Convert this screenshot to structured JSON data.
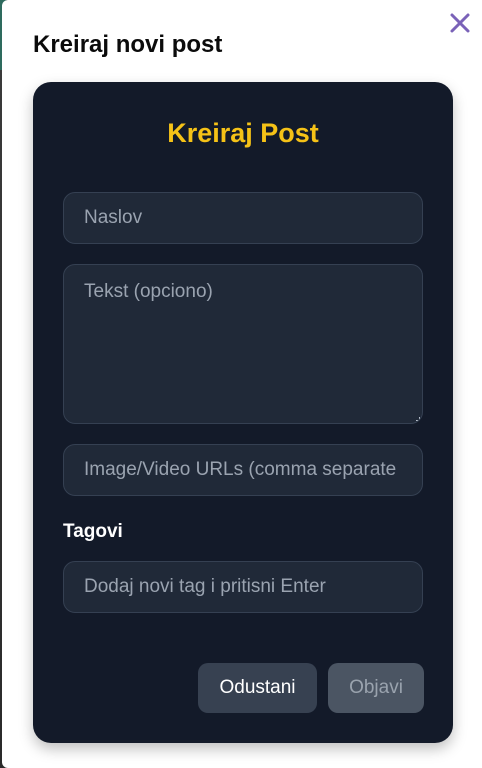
{
  "modal": {
    "title": "Kreiraj novi post",
    "close_icon": "close-icon"
  },
  "form": {
    "heading": "Kreiraj Post",
    "title_placeholder": "Naslov",
    "text_placeholder": "Tekst (opciono)",
    "media_placeholder": "Image/Video URLs (comma separate",
    "tags_label": "Tagovi",
    "tag_placeholder": "Dodaj novi tag i pritisni Enter"
  },
  "actions": {
    "cancel_label": "Odustani",
    "publish_label": "Objavi"
  },
  "colors": {
    "accent": "#f5c217",
    "card_bg": "#131a29",
    "field_bg": "#202938",
    "close_icon": "#7a62b8"
  }
}
